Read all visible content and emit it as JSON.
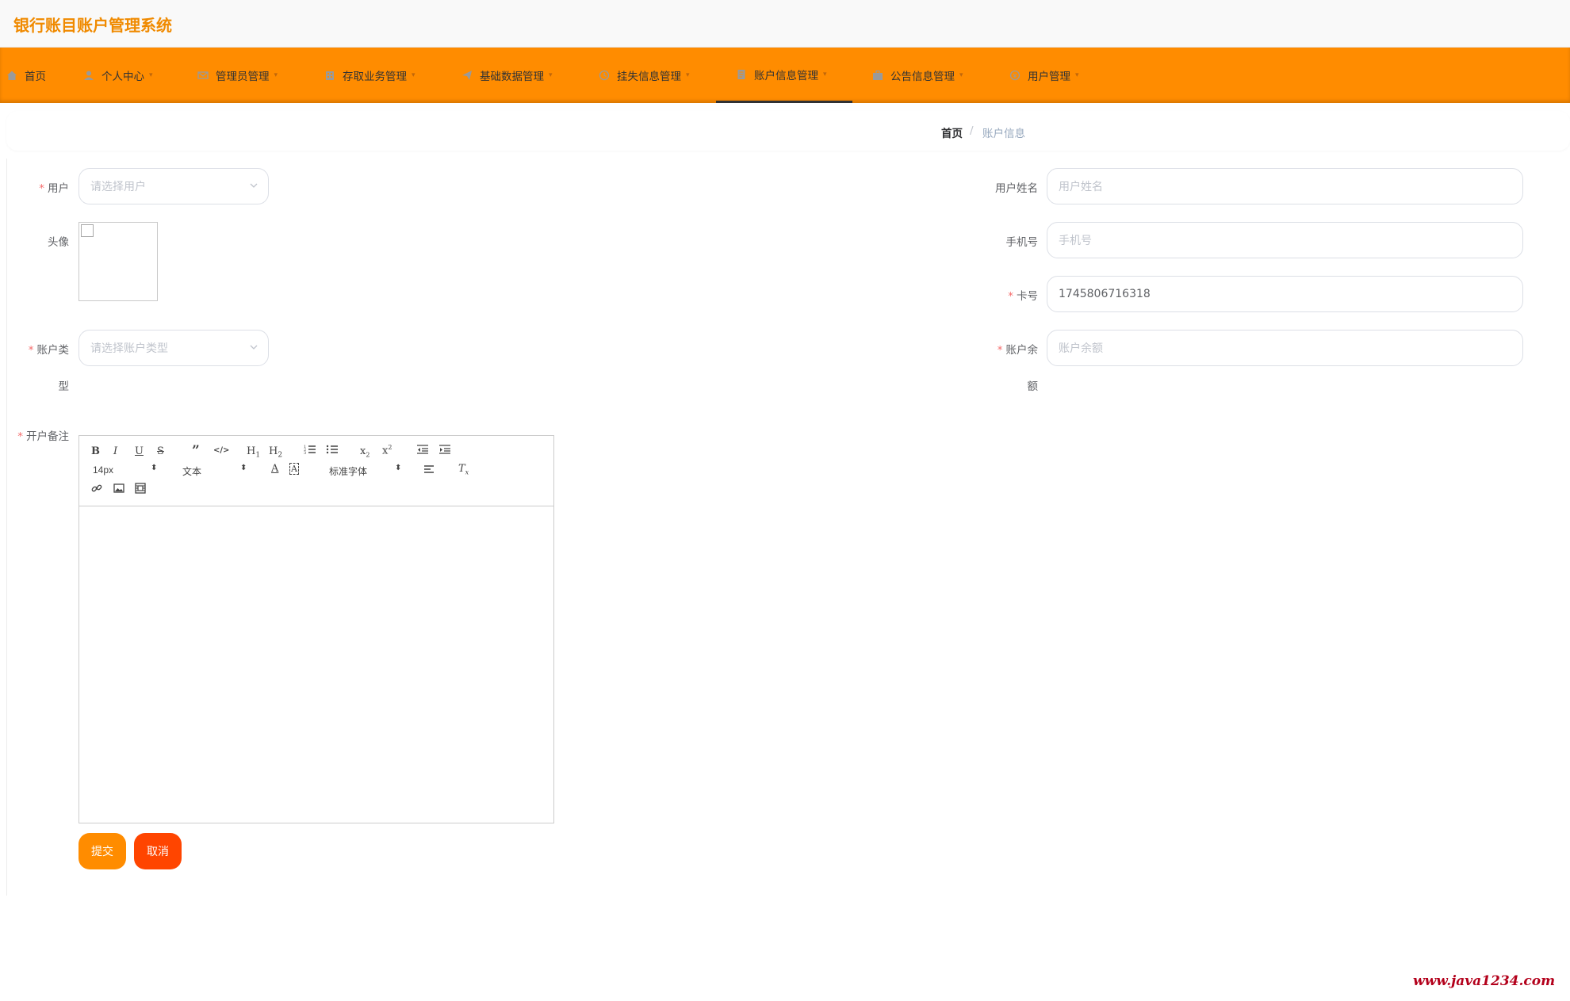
{
  "app": {
    "title": "银行账目账户管理系统"
  },
  "nav": [
    {
      "label": "首页",
      "icon": "home-icon"
    },
    {
      "label": "个人中心",
      "icon": "user-icon"
    },
    {
      "label": "管理员管理",
      "icon": "mail-icon"
    },
    {
      "label": "存取业务管理",
      "icon": "building-icon"
    },
    {
      "label": "基础数据管理",
      "icon": "send-icon"
    },
    {
      "label": "挂失信息管理",
      "icon": "clock-icon"
    },
    {
      "label": "账户信息管理",
      "icon": "document-icon",
      "active": true
    },
    {
      "label": "公告信息管理",
      "icon": "briefcase-icon"
    },
    {
      "label": "用户管理",
      "icon": "coin-icon"
    }
  ],
  "breadcrumb": {
    "home": "首页",
    "separator": "/",
    "current": "账户信息"
  },
  "form": {
    "user": {
      "label": "用户",
      "required": true,
      "placeholder": "请选择用户"
    },
    "avatar": {
      "label": "头像"
    },
    "account_type": {
      "label_line1": "账户类",
      "label_line2": "型",
      "required": true,
      "placeholder": "请选择账户类型"
    },
    "user_name": {
      "label": "用户姓名",
      "placeholder": "用户姓名"
    },
    "phone": {
      "label": "手机号",
      "placeholder": "手机号"
    },
    "card_no": {
      "label": "卡号",
      "required": true,
      "value": "1745806716318"
    },
    "balance": {
      "label_line1": "账户余",
      "label_line2": "额",
      "required": true,
      "placeholder": "账户余额"
    },
    "remarks": {
      "label": "开户备注",
      "required": true
    }
  },
  "editor": {
    "font_size": "14px",
    "format": "文本",
    "font_family": "标准字体"
  },
  "buttons": {
    "submit": "提交",
    "cancel": "取消"
  },
  "colors": {
    "primary": "#ff8c00",
    "title": "#f08a00",
    "cancel": "#ff4500",
    "required": "#f56c6c"
  },
  "watermark": "www.java1234.com"
}
